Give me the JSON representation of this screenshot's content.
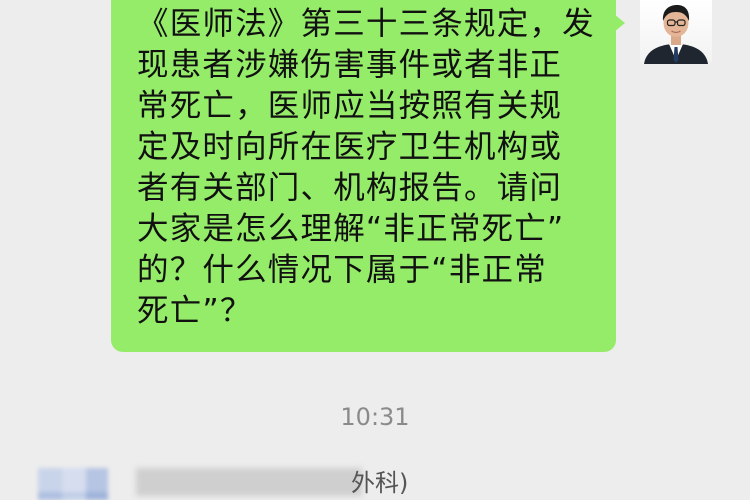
{
  "message": {
    "lines": [
      "《医师法》第三十三条规定，发",
      "现患者涉嫌伤害事件或者非正",
      "常死亡，医师应当按照有关规",
      "定及时向所在医疗卫生机构或",
      "者有关部门、机构报告。请问",
      "大家是怎么理解“非正常死亡”",
      "的？什么情况下属于“非正常",
      "死亡”？"
    ]
  },
  "timestamp": "10:31",
  "incoming": {
    "sender_visible_text": "外科)"
  },
  "colors": {
    "background": "#ededed",
    "outgoing_bubble": "#95ec69",
    "timestamp_text": "#8a8a8a"
  }
}
